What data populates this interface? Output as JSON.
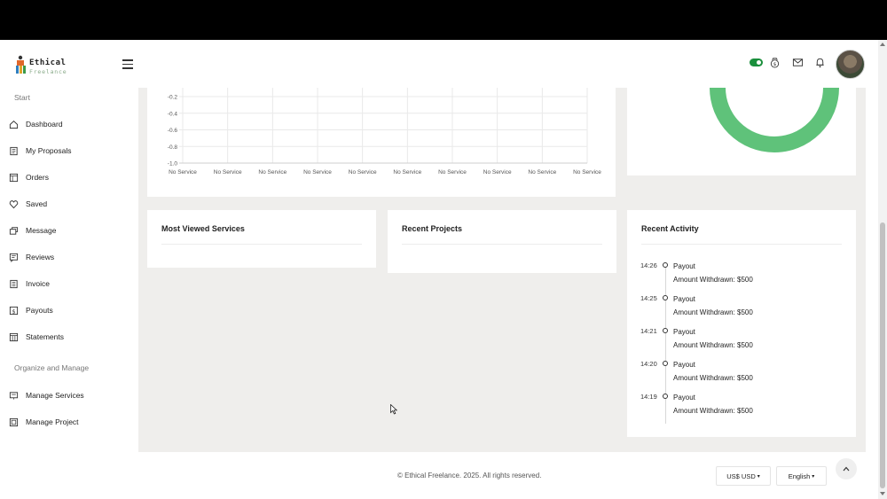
{
  "brand": {
    "name": "Ethical",
    "tagline": "Freelance"
  },
  "sidebar": {
    "section_start": "Start",
    "items_start": [
      {
        "label": "Dashboard",
        "icon": "home-icon"
      },
      {
        "label": "My Proposals",
        "icon": "document-icon"
      },
      {
        "label": "Orders",
        "icon": "orders-icon"
      },
      {
        "label": "Saved",
        "icon": "heart-icon"
      },
      {
        "label": "Message",
        "icon": "message-icon"
      },
      {
        "label": "Reviews",
        "icon": "reviews-icon"
      },
      {
        "label": "Invoice",
        "icon": "invoice-icon"
      },
      {
        "label": "Payouts",
        "icon": "payout-icon"
      },
      {
        "label": "Statements",
        "icon": "statement-icon"
      }
    ],
    "section_manage": "Organize and Manage",
    "items_manage": [
      {
        "label": "Manage Services",
        "icon": "services-icon"
      },
      {
        "label": "Manage Project",
        "icon": "project-icon"
      }
    ]
  },
  "chart_data": {
    "type": "line",
    "title": "",
    "xlabel": "",
    "ylabel": "",
    "categories": [
      "No Service",
      "No Service",
      "No Service",
      "No Service",
      "No Service",
      "No Service",
      "No Service",
      "No Service",
      "No Service",
      "No Service"
    ],
    "y_ticks": [
      "-0.2",
      "-0.4",
      "-0.6",
      "-0.8",
      "-1.0"
    ],
    "ylim": [
      -1.0,
      -0.2
    ],
    "grid": true,
    "series": []
  },
  "donut": {
    "color": "#5fc27a"
  },
  "cards": {
    "most_viewed_title": "Most Viewed Services",
    "recent_projects_title": "Recent Projects",
    "recent_activity_title": "Recent Activity"
  },
  "activity": [
    {
      "time": "14:26",
      "title": "Payout",
      "desc": "Amount Withdrawn: $500"
    },
    {
      "time": "14:25",
      "title": "Payout",
      "desc": "Amount Withdrawn: $500"
    },
    {
      "time": "14:21",
      "title": "Payout",
      "desc": "Amount Withdrawn: $500"
    },
    {
      "time": "14:20",
      "title": "Payout",
      "desc": "Amount Withdrawn: $500"
    },
    {
      "time": "14:19",
      "title": "Payout",
      "desc": "Amount Withdrawn: $500"
    }
  ],
  "footer": {
    "copyright": "© Ethical Freelance. 2025. All rights reserved.",
    "currency": "US$ USD",
    "language": "English"
  },
  "colors": {
    "accent": "#1a8f3c",
    "donut": "#5fc27a",
    "content_bg": "#efeeec"
  }
}
